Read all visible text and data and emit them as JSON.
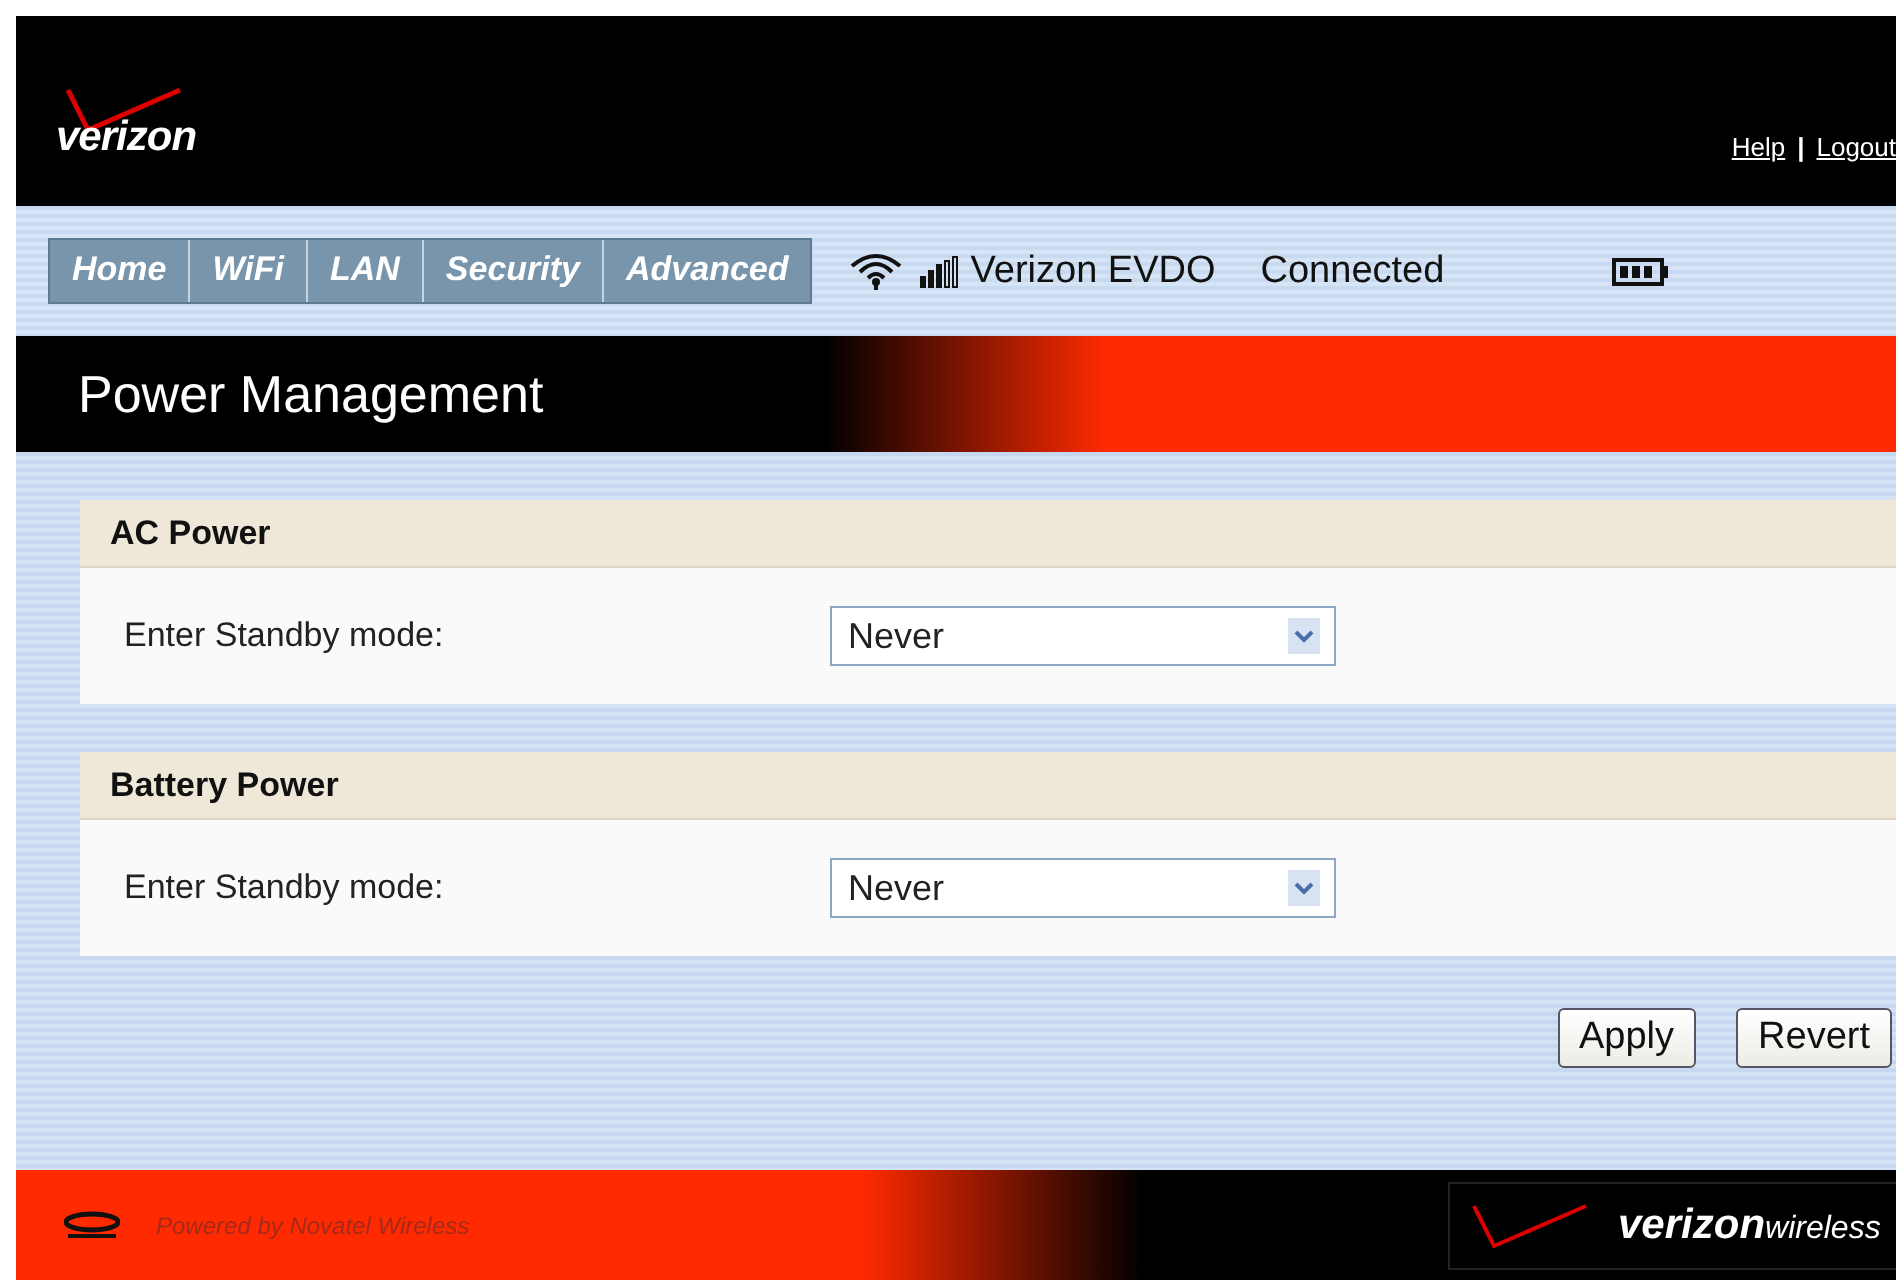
{
  "header": {
    "logo": "verizon",
    "links": [
      {
        "label": "Help"
      },
      {
        "label": "Logout"
      }
    ],
    "separator": "|"
  },
  "tabs": [
    {
      "label": "Home",
      "selected": false
    },
    {
      "label": "WiFi",
      "selected": false
    },
    {
      "label": "LAN",
      "selected": false
    },
    {
      "label": "Security",
      "selected": false
    },
    {
      "label": "Advanced",
      "selected": false
    }
  ],
  "status": {
    "network": "Verizon EVDO",
    "connection": "Connected"
  },
  "page_title": "Power Management",
  "sections": [
    {
      "title": "AC Power",
      "label": "Enter Standby mode:",
      "value": "Never"
    },
    {
      "title": "Battery Power",
      "label": "Enter Standby mode:",
      "value": "Never"
    }
  ],
  "buttons": [
    {
      "label": "Apply"
    },
    {
      "label": "Revert"
    }
  ],
  "footer": {
    "powered_by": "Powered by Novatel Wireless",
    "logo": "verizon",
    "logo_suffix": "wireless"
  }
}
